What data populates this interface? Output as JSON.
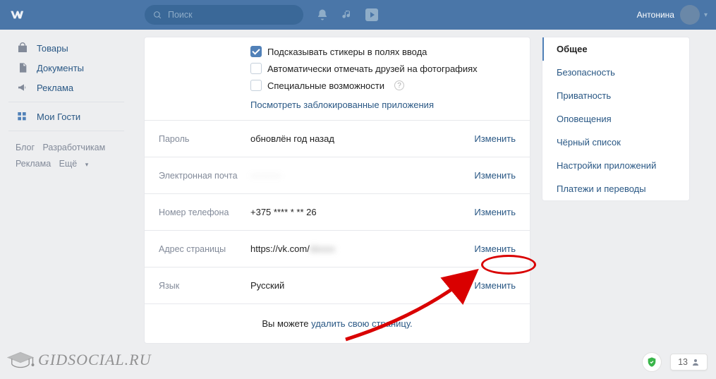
{
  "header": {
    "search_placeholder": "Поиск",
    "user_name": "Антонина"
  },
  "sidebar": {
    "items": [
      {
        "icon": "bag-icon",
        "label": "Товары"
      },
      {
        "icon": "doc-icon",
        "label": "Документы"
      },
      {
        "icon": "horn-icon",
        "label": "Реклама"
      }
    ],
    "guests_label": "Мои Гости",
    "footer_links": [
      "Блог",
      "Разработчикам",
      "Реклама",
      "Ещё"
    ]
  },
  "settings": {
    "checkboxes": [
      {
        "checked": true,
        "label": "Подсказывать стикеры в полях ввода"
      },
      {
        "checked": false,
        "label": "Автоматически отмечать друзей на фотографиях"
      },
      {
        "checked": false,
        "label": "Специальные возможности",
        "help": true
      }
    ],
    "view_blocked": "Посмотреть заблокированные приложения",
    "rows": [
      {
        "label": "Пароль",
        "value": "обновлён год назад",
        "action": "Изменить"
      },
      {
        "label": "Электронная почта",
        "value": "··········",
        "action": "Изменить",
        "blurred": true
      },
      {
        "label": "Номер телефона",
        "value": "+375 **** * ** 26",
        "action": "Изменить"
      },
      {
        "label": "Адрес страницы",
        "value": "https://vk.com/",
        "action": "Изменить",
        "blurred_suffix": true,
        "highlighted": true
      },
      {
        "label": "Язык",
        "value": "Русский",
        "action": "Изменить"
      }
    ],
    "delete_prefix": "Вы можете ",
    "delete_link": "удалить свою страницу."
  },
  "right_nav": {
    "items": [
      "Общее",
      "Безопасность",
      "Приватность",
      "Оповещения",
      "Чёрный список",
      "Настройки приложений",
      "Платежи и переводы"
    ],
    "active_index": 0
  },
  "watermark": {
    "text": "GIDSOCIAL.RU"
  },
  "bottom_counter": "13"
}
